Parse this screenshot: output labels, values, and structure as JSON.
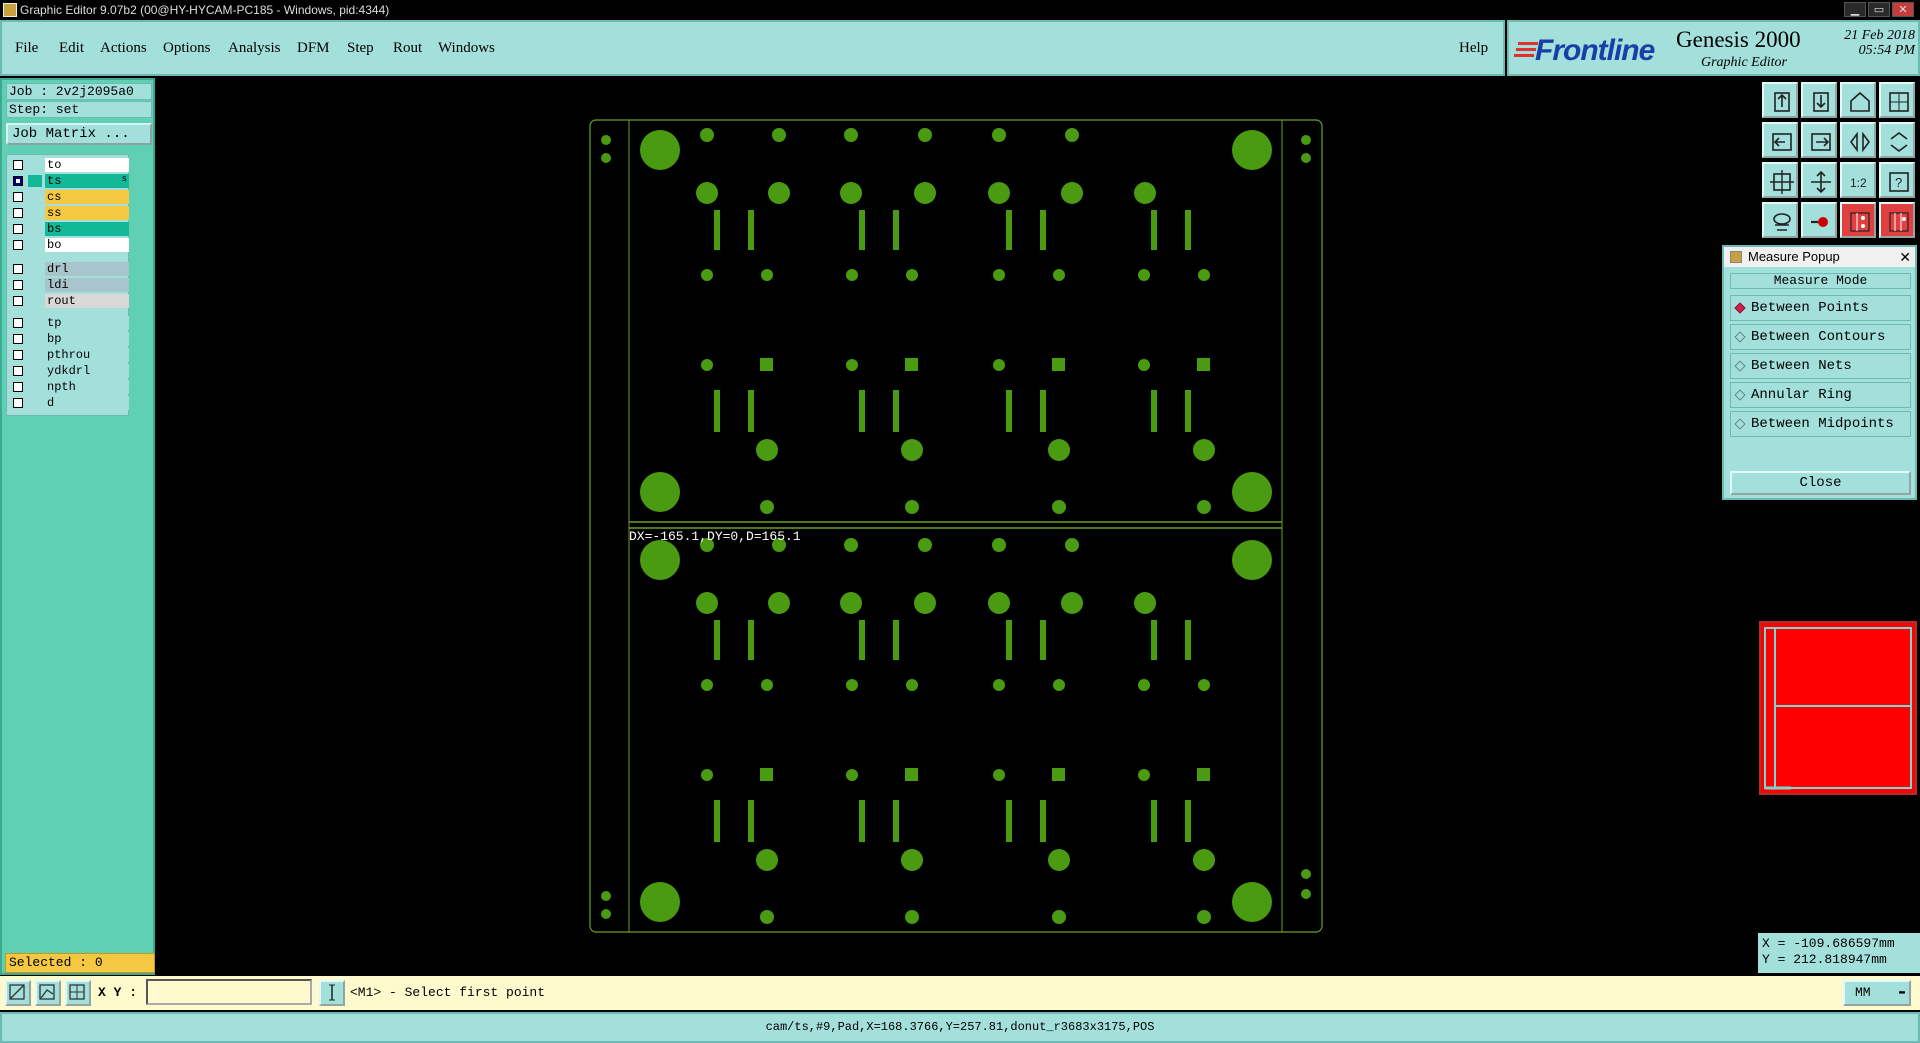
{
  "window": {
    "title": "Graphic Editor 9.07b2 (00@HY-HYCAM-PC185 - Windows, pid:4344)",
    "min": "▁",
    "max": "▭",
    "close": "✕"
  },
  "menu": {
    "items": [
      "File",
      "Edit",
      "Actions",
      "Options",
      "Analysis",
      "DFM",
      "Step",
      "Rout",
      "Windows"
    ],
    "help": "Help"
  },
  "brand": {
    "logo": "Frontline",
    "product": "Genesis 2000",
    "subtitle": "Graphic Editor",
    "date": "21 Feb 2018",
    "time": "05:54 PM",
    "logo_color": "#1a3ea8"
  },
  "job": {
    "job": "Job : 2v2j2095a0",
    "step": "Step: set",
    "matrix_button": "Job Matrix ..."
  },
  "layers": [
    {
      "name": "to",
      "color": "#ffffff",
      "on": false,
      "group": 0
    },
    {
      "name": "ts",
      "color": "#12b898",
      "on": true,
      "group": 0,
      "flag": "s"
    },
    {
      "name": "cs",
      "color": "#f5c842",
      "on": false,
      "group": 0
    },
    {
      "name": "ss",
      "color": "#f5c842",
      "on": false,
      "group": 0
    },
    {
      "name": "bs",
      "color": "#12b898",
      "on": false,
      "group": 0
    },
    {
      "name": "bo",
      "color": "#ffffff",
      "on": false,
      "group": 0
    },
    {
      "name": "drl",
      "color": "#a8c4cc",
      "on": false,
      "group": 1
    },
    {
      "name": "ldi",
      "color": "#a8c4cc",
      "on": false,
      "group": 1
    },
    {
      "name": "rout",
      "color": "#d8d8d8",
      "on": false,
      "group": 1
    },
    {
      "name": "tp",
      "color": "#a3e0dc",
      "on": false,
      "group": 2
    },
    {
      "name": "bp",
      "color": "#a3e0dc",
      "on": false,
      "group": 2
    },
    {
      "name": "pthrou",
      "color": "#a3e0dc",
      "on": false,
      "group": 2
    },
    {
      "name": "ydkdrl",
      "color": "#a3e0dc",
      "on": false,
      "group": 2
    },
    {
      "name": "npth",
      "color": "#a3e0dc",
      "on": false,
      "group": 2
    },
    {
      "name": "d",
      "color": "#a3e0dc",
      "on": false,
      "group": 2
    }
  ],
  "selected": "Selected : 0",
  "measure_popup": {
    "title": "Measure Popup",
    "header": "Measure Mode",
    "options": [
      "Between Points",
      "Between Contours",
      "Between Nets",
      "Annular Ring",
      "Between Midpoints"
    ],
    "active": 0,
    "close_label": "Close",
    "close_icon": "✕"
  },
  "coords": {
    "x": "X = -109.686597mm",
    "y": "Y = 212.818947mm"
  },
  "bottom": {
    "xy_label": "X Y :",
    "xy_value": "",
    "prompt": "<M1> - Select first point",
    "units": "MM"
  },
  "status_line": "cam/ts,#9,Pad,X=168.3766,Y=257.81,donut_r3683x3175,POS",
  "canvas": {
    "measure_text": "DX=-165.1,DY=0,D=165.1",
    "pad_color": "#4a9a12",
    "outline_color": "#6aa020"
  },
  "toolbar_icons": [
    "zoom-home-icon",
    "zoom-back-icon",
    "home-icon",
    "window-icon",
    "pan-left-icon",
    "pan-right-icon",
    "mirror-icon",
    "flip-icon",
    "fit-icon",
    "center-icon",
    "scale-1-2-icon",
    "help-icon",
    "filter-icon",
    "measure-tool-icon",
    "layers-red-icon",
    "layers-red-2-icon"
  ]
}
